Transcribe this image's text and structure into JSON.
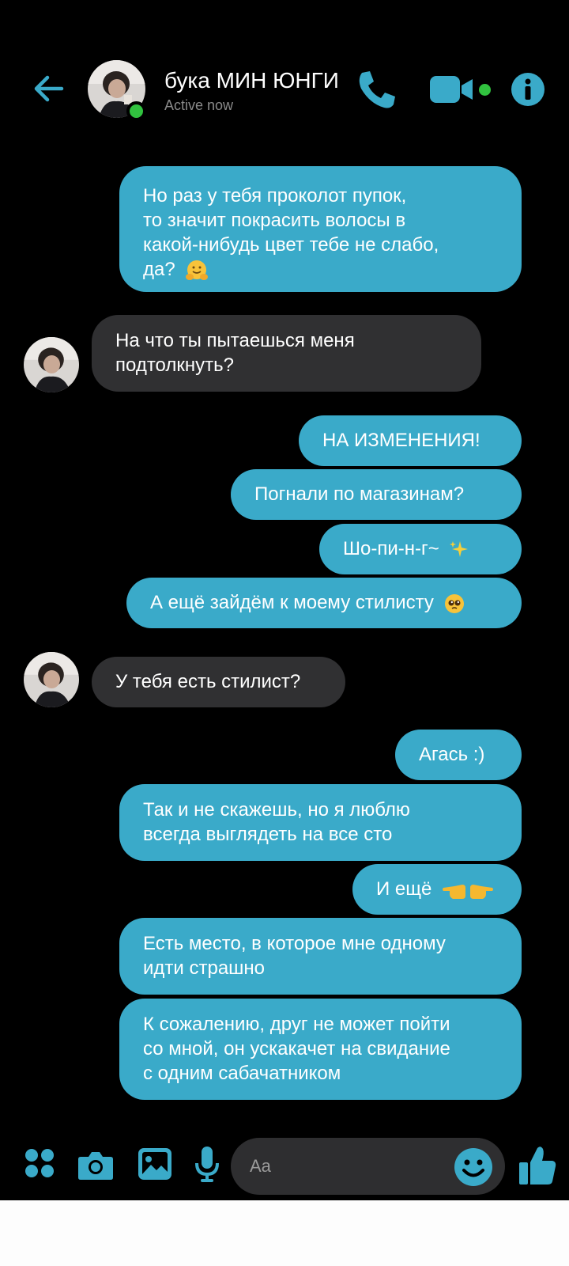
{
  "header": {
    "contact_name": "бука МИН ЮНГИ",
    "status": "Active now",
    "accent": "#3aaac9",
    "online_color": "#31c23f"
  },
  "messages": [
    {
      "side": "out",
      "text": "Но раз у тебя проколот пупок,\nто значит покрасить волосы в\nкакой-нибудь цвет тебе не слабо,\nда?",
      "emoji": "hugging-face"
    },
    {
      "side": "in",
      "text": "На что ты пытаешься меня\nподтолкнуть?"
    },
    {
      "side": "out",
      "text": "НА ИЗМЕНЕНИЯ!"
    },
    {
      "side": "out",
      "text": "Погнали по магазинам?"
    },
    {
      "side": "out",
      "text": "Шо-пи-н-г~",
      "emoji": "sparkles"
    },
    {
      "side": "out",
      "text": "А ещё зайдём к моему стилисту",
      "emoji": "pleading-face"
    },
    {
      "side": "in",
      "text": "У тебя есть стилист?"
    },
    {
      "side": "out",
      "text": "Агась :)"
    },
    {
      "side": "out",
      "text": "Так и не скажешь, но я люблю\nвсегда выглядеть на все сто"
    },
    {
      "side": "out",
      "text": "И ещё",
      "emoji": "pointing-fingers"
    },
    {
      "side": "out",
      "text": "Есть место, в которое мне одному\nидти страшно"
    },
    {
      "side": "out",
      "text": "К сожалению, друг не может пойти\nсо мной, он ускакачет на свидание\nс одним сабачатником"
    }
  ],
  "composer": {
    "placeholder": "Aa",
    "icons": [
      "apps-icon",
      "camera-icon",
      "gallery-icon",
      "microphone-icon",
      "emoji-icon",
      "thumbs-up-icon"
    ]
  }
}
